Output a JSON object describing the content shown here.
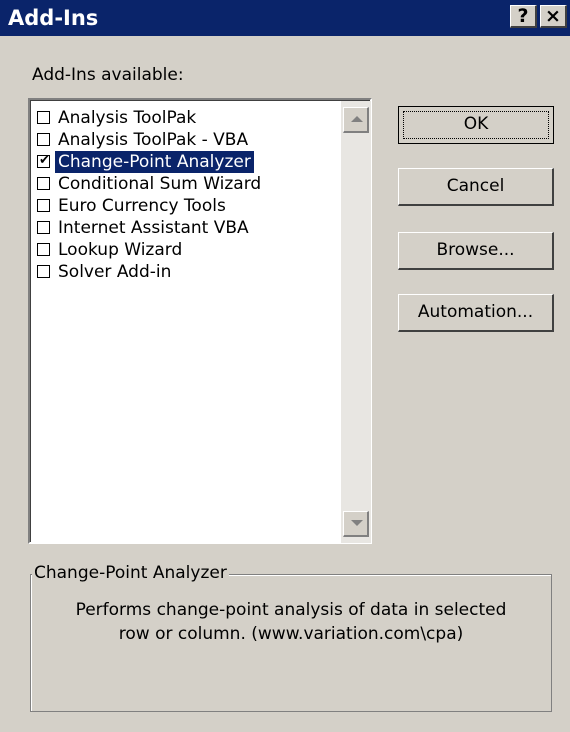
{
  "window": {
    "title": "Add-Ins"
  },
  "titlebar": {
    "help_label": "?",
    "close_label": "×"
  },
  "list": {
    "label": "Add-Ins available:",
    "items": [
      {
        "label": "Analysis ToolPak",
        "checked": false
      },
      {
        "label": "Analysis ToolPak - VBA",
        "checked": false
      },
      {
        "label": "Change-Point Analyzer",
        "checked": true,
        "selected": true
      },
      {
        "label": "Conditional Sum Wizard",
        "checked": false
      },
      {
        "label": "Euro Currency Tools",
        "checked": false
      },
      {
        "label": "Internet Assistant VBA",
        "checked": false
      },
      {
        "label": "Lookup Wizard",
        "checked": false
      },
      {
        "label": "Solver Add-in",
        "checked": false
      }
    ]
  },
  "buttons": {
    "ok": "OK",
    "cancel": "Cancel",
    "browse": "Browse...",
    "automation": "Automation..."
  },
  "description": {
    "title": "Change-Point Analyzer",
    "text": "Performs change-point analysis of data in selected\nrow or column.  (www.variation.com\\cpa)"
  },
  "colors": {
    "titlebar": "#0a246a",
    "face": "#d4d0c8",
    "selection": "#0a246a"
  }
}
